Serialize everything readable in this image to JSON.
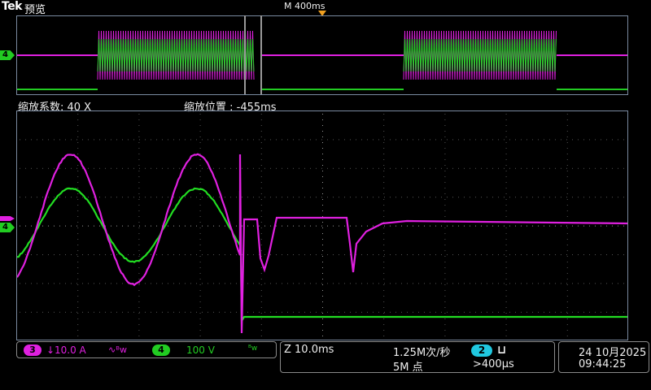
{
  "header": {
    "brand": "Tek",
    "mode": "预览",
    "timebase": "M 400ms"
  },
  "zoom": {
    "factor_label": "缩放系数: 40 X",
    "position_label": "缩放位置 : -455ms"
  },
  "channels": {
    "ch3": {
      "number": "3",
      "coupling_symbol": "↓",
      "scale": "10.0 A",
      "bw_symbol": "∿ᴮw",
      "color": "#e020e0"
    },
    "ch4": {
      "number": "4",
      "scale": "100 V",
      "bw_symbol": "ᴮw",
      "color": "#22cc22"
    }
  },
  "acquisition": {
    "zoom_scale": "Z 10.0ms",
    "sample_rate": "1.25M次/秒",
    "record_length": "5M 点",
    "trigger_source": "2",
    "trigger_edge_symbol": "⊔",
    "trigger_level": ">400µs"
  },
  "datetime": {
    "date": "24 10月2025",
    "time": "09:44:25"
  },
  "markers": {
    "overview_ch4": "4",
    "main_ch4": "4"
  }
}
